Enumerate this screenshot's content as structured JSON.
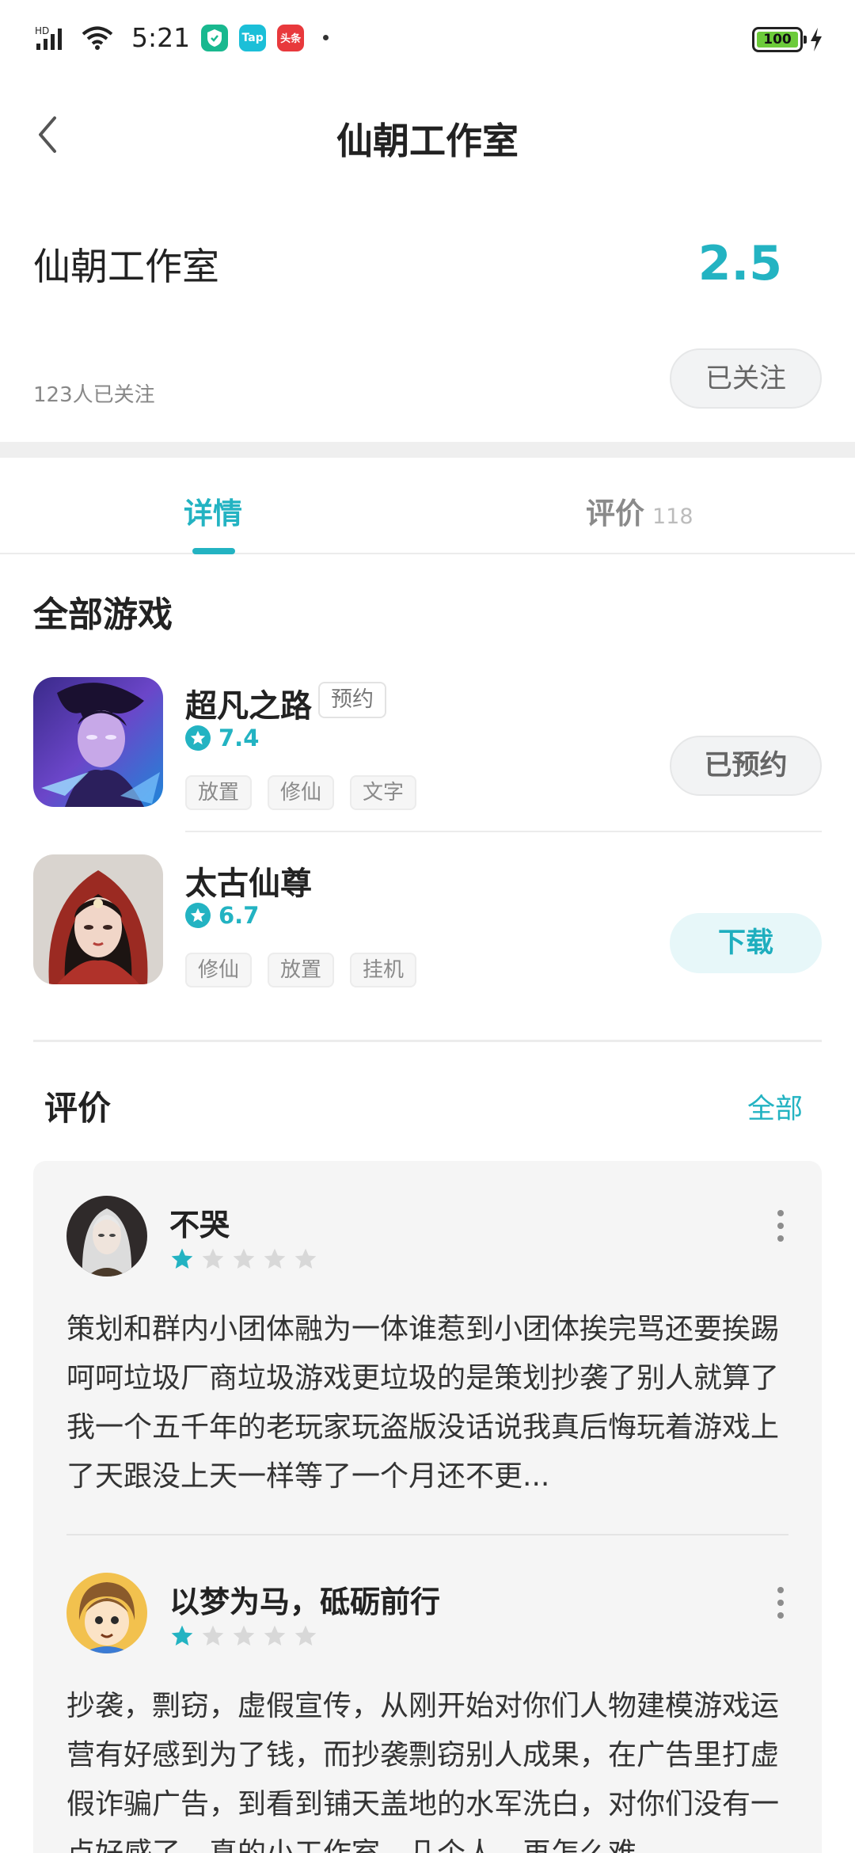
{
  "status_bar": {
    "network_label": "HD",
    "time": "5:21",
    "apps": [
      {
        "name": "shield-app",
        "color": "#19b88f",
        "text": "✓"
      },
      {
        "name": "taptap-app",
        "color": "#1bbfd8",
        "text": "Tap"
      },
      {
        "name": "toutiao-app",
        "color": "#e8393c",
        "text": "头条"
      }
    ],
    "battery": "100"
  },
  "header": {
    "title": "仙朝工作室",
    "back_icon": "chevron-left-icon"
  },
  "studio": {
    "name": "仙朝工作室",
    "score": "2.5",
    "followers": "123人已关注",
    "follow_button": "已关注"
  },
  "tabs": {
    "details": "详情",
    "reviews": "评价",
    "reviews_count": "118"
  },
  "games_section": {
    "title": "全部游戏",
    "games": [
      {
        "name": "超凡之路",
        "badge": "预约",
        "rating": "7.4",
        "tags": [
          "放置",
          "修仙",
          "文字"
        ],
        "button": "已预约"
      },
      {
        "name": "太古仙尊",
        "rating": "6.7",
        "tags": [
          "修仙",
          "放置",
          "挂机"
        ],
        "button": "下载"
      }
    ]
  },
  "reviews_section": {
    "title": "评价",
    "all_link": "全部",
    "reviews": [
      {
        "user": "不哭",
        "stars": 1,
        "text": "策划和群内小团体融为一体谁惹到小团体挨完骂还要挨踢呵呵垃圾厂商垃圾游戏更垃圾的是策划抄袭了别人就算了我一个五千年的老玩家玩盗版没话说我真后悔玩着游戏上了天跟没上天一样等了一个月还不更..."
      },
      {
        "user": "以梦为马，砥砺前行",
        "stars": 1,
        "text": "抄袭，剽窃，虚假宣传，从刚开始对你们人物建模游戏运营有好感到为了钱，而抄袭剽窃别人成果，在广告里打虚假诈骗广告，到看到铺天盖地的水军洗白，对你们没有一点好感了，真的小工作室，几个人，再怎么难"
      }
    ]
  },
  "colors": {
    "accent": "#23b3c2",
    "star_empty": "#d8d8d8"
  }
}
